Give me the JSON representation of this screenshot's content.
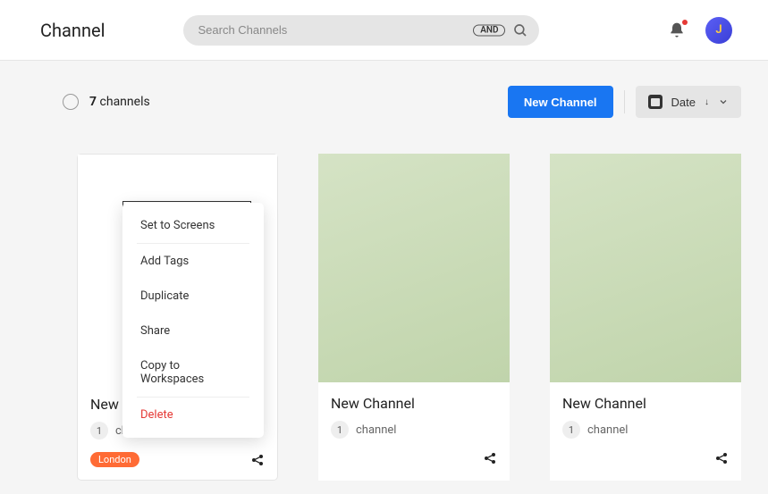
{
  "header": {
    "title": "Channel",
    "search_placeholder": "Search Channels",
    "and_badge": "AND",
    "avatar_initial": "J"
  },
  "toolbar": {
    "count_number": "7",
    "count_label": "channels",
    "new_button": "New Channel",
    "sort_label": "Date",
    "sort_arrow": "↓"
  },
  "cards": [
    {
      "title": "New",
      "count": "1",
      "meta_text": "ch",
      "tag": "London"
    },
    {
      "title": "New Channel",
      "count": "1",
      "meta_text": "channel"
    },
    {
      "title": "New Channel",
      "count": "1",
      "meta_text": "channel"
    }
  ],
  "context_menu": {
    "items": [
      "Set to Screens",
      "Add Tags",
      "Duplicate",
      "Share",
      "Copy to Workspaces"
    ],
    "delete": "Delete"
  }
}
